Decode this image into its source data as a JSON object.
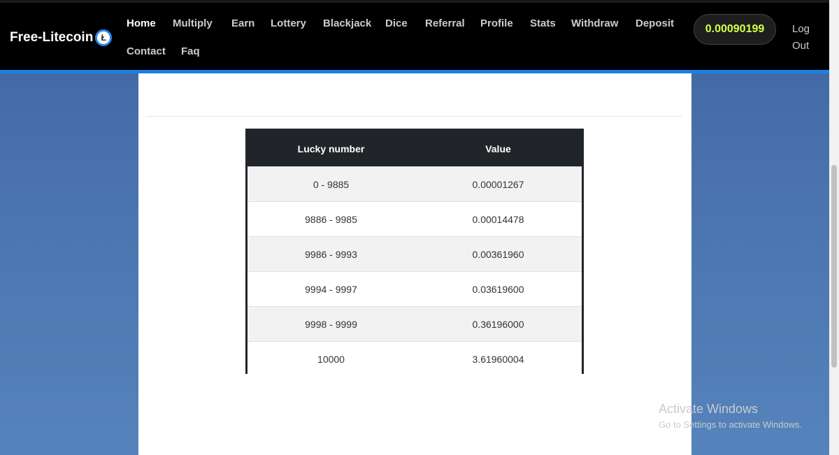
{
  "brand": {
    "name": "Free-Litecoin"
  },
  "nav": {
    "row1": [
      "Home",
      "Multiply",
      "Earn",
      "Lottery",
      "Blackjack",
      "Dice",
      "Referral",
      "Profile",
      "Stats",
      "Withdraw",
      "Deposit"
    ],
    "row2": [
      "Contact",
      "Faq"
    ],
    "active": "Home"
  },
  "balance": "0.00090199",
  "logout": [
    "Log",
    "Out"
  ],
  "table": {
    "headers": [
      "Lucky number",
      "Value"
    ],
    "rows": [
      [
        "0 - 9885",
        "0.00001267"
      ],
      [
        "9886 - 9985",
        "0.00014478"
      ],
      [
        "9986 - 9993",
        "0.00361960"
      ],
      [
        "9994 - 9997",
        "0.03619600"
      ],
      [
        "9998 - 9999",
        "0.36196000"
      ],
      [
        "10000",
        "3.61960004"
      ]
    ]
  },
  "watermark": {
    "title": "Activate Windows",
    "subtitle": "Go to Settings to activate Windows."
  },
  "colors": {
    "accent": "#1e7fe6",
    "balance": "#d6ff47",
    "navbar": "#000000",
    "table_header": "#212529"
  }
}
